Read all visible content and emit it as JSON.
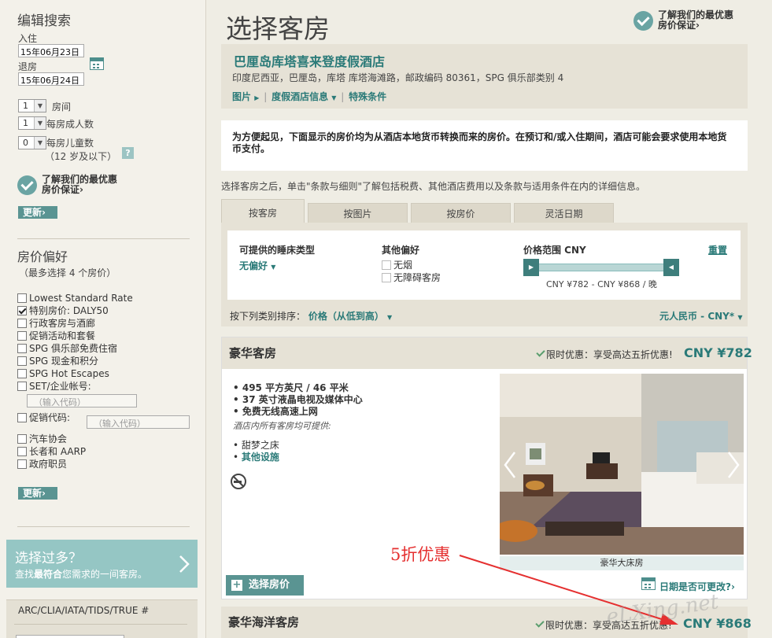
{
  "sidebar": {
    "edit_search_title": "编辑搜索",
    "checkin_label": "入住",
    "checkin_value": "15年06月23日",
    "checkout_label": "退房",
    "checkout_value": "15年06月24日",
    "rooms_value": "1",
    "rooms_label": "房间",
    "adults_value": "1",
    "adults_label": "每房成人数",
    "children_value": "0",
    "children_label": "每房儿童数",
    "children_note": "（12 岁及以下）",
    "help": "?",
    "guarantee_line1": "了解我们的最优惠",
    "guarantee_line2": "房价保证",
    "update_label": "更新",
    "rate_pref_title": "房价偏好",
    "rate_pref_note": "（最多选择 4 个房价）",
    "rates": [
      {
        "label": "Lowest Standard Rate",
        "checked": false
      },
      {
        "label": "特别房价: DALY50",
        "checked": true
      },
      {
        "label": "行政客房与酒廊",
        "checked": false
      },
      {
        "label": "促销活动和套餐",
        "checked": false
      },
      {
        "label": "SPG 俱乐部免费住宿",
        "checked": false
      },
      {
        "label": "SPG 现金和积分",
        "checked": false
      },
      {
        "label": "SPG Hot Escapes",
        "checked": false
      },
      {
        "label": "SET/企业帐号:",
        "checked": false
      }
    ],
    "code_placeholder": "（输入代码）",
    "promo_code_label": "促销代码:",
    "affiliations": [
      {
        "label": "汽车协会"
      },
      {
        "label": "长者和 AARP"
      },
      {
        "label": "政府职员"
      }
    ],
    "promo_title": "选择过多？",
    "promo_text_pre": "查找",
    "promo_text_bold": "最符合",
    "promo_text_post": "您需求的一间客房。",
    "arc_label": "ARC/CLIA/IATA/TIDS/TRUE #"
  },
  "main": {
    "title": "选择客房",
    "guarantee_line1": "了解我们的最优惠",
    "guarantee_line2": "房价保证",
    "hotel_name": "巴厘岛库塔喜来登度假酒店",
    "hotel_address": "印度尼西亚，巴厘岛，库塔 库塔海滩路，邮政编码 80361，SPG 俱乐部类别 4",
    "links": [
      "图片",
      "度假酒店信息",
      "特殊条件"
    ],
    "notice": "为方便起见，下面显示的房价均为从酒店本地货币转换而来的房价。在预订和/或入住期间，酒店可能会要求使用本地货币支付。",
    "terms_note": "选择客房之后，单击\"条款与细则\"了解包括税费、其他酒店费用以及条款与适用条件在内的详细信息。",
    "tabs": [
      "按客房",
      "按图片",
      "按房价",
      "灵活日期"
    ],
    "filter": {
      "bed_type_title": "可提供的睡床类型",
      "bed_type_value": "无偏好",
      "other_title": "其他偏好",
      "option_nonsmoking": "无烟",
      "option_accessible": "无障碍客房",
      "price_title": "价格范围 CNY",
      "reset": "重置",
      "price_range": "CNY ¥782 - CNY ¥868 / 晚",
      "sort_label": "按下列类别排序：",
      "sort_value": "价格（从低到高）",
      "currency": "元人民币 - CNY*"
    },
    "room1": {
      "name": "豪华客房",
      "offer": "限时优惠：享受高达五折优惠!",
      "price": "CNY ¥782",
      "features": [
        "495 平方英尺 / 46 平米",
        "37 英寸液晶电视及媒体中心",
        "免费无线高速上网"
      ],
      "all_rooms_note": "酒店内所有客房均可提供:",
      "extra_features": [
        "甜梦之床"
      ],
      "more_link": "其他设施",
      "image_caption": "豪华大床房",
      "select_label": "选择房价",
      "date_flex": "日期是否可更改?",
      "annotation": "5折优惠"
    },
    "room2": {
      "name": "豪华海洋客房",
      "offer": "限时优惠：享受高达五折优惠!",
      "price": "CNY ¥868"
    },
    "watermark": "eLXing.net"
  },
  "colors": {
    "teal": "#5a9492",
    "teal_link": "#2a7a78",
    "red_annotation": "#e53030",
    "background": "#efede4"
  }
}
